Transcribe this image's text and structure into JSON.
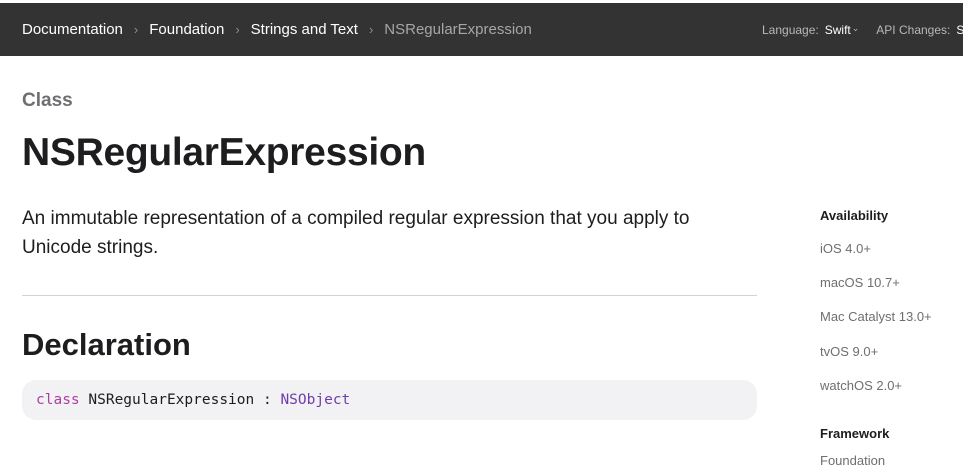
{
  "nav": {
    "breadcrumbs": [
      "Documentation",
      "Foundation",
      "Strings and Text",
      "NSRegularExpression"
    ],
    "separator": "›",
    "language_label": "Language:",
    "language_value": "Swift",
    "api_changes_label": "API Changes:",
    "api_changes_value": "S"
  },
  "page": {
    "kicker": "Class",
    "title": "NSRegularExpression",
    "abstract": "An immutable representation of a compiled regular expression that you apply to Unicode strings.",
    "declaration_heading": "Declaration",
    "declaration": {
      "keyword": "class",
      "name": " NSRegularExpression : ",
      "superclass": "NSObject"
    }
  },
  "sidebar": {
    "availability_label": "Availability",
    "availability": [
      "iOS 4.0+",
      "macOS 10.7+",
      "Mac Catalyst 13.0+",
      "tvOS 9.0+",
      "watchOS 2.0+"
    ],
    "framework_label": "Framework",
    "framework": "Foundation"
  },
  "colors": {
    "nav_background": "#333333",
    "keyword": "#ad3da4",
    "type_link": "#703daa",
    "code_background": "#f2f2f4"
  }
}
